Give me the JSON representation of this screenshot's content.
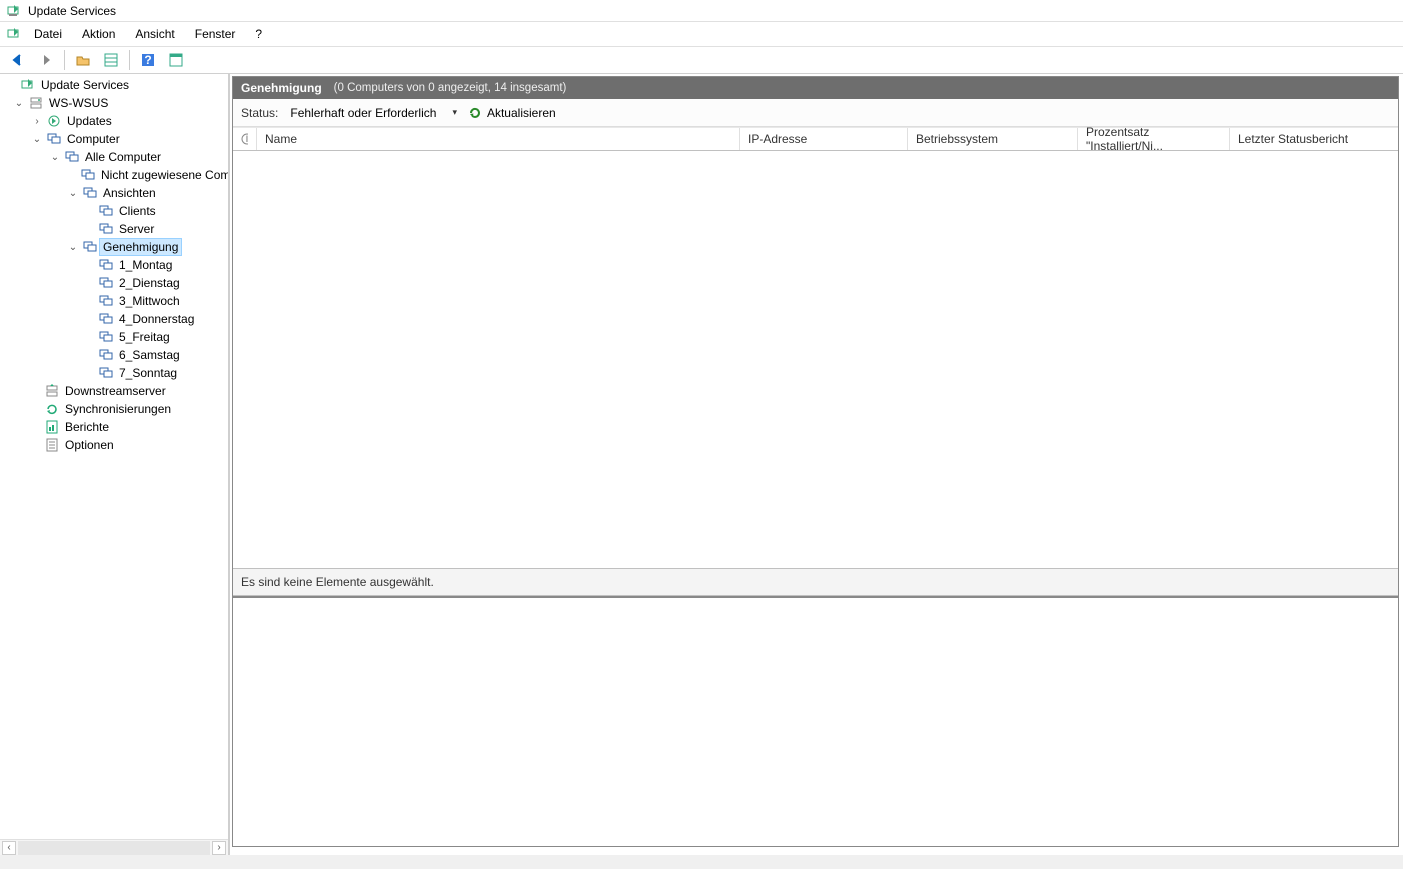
{
  "window": {
    "title": "Update Services"
  },
  "menu": {
    "items": [
      "Datei",
      "Aktion",
      "Ansicht",
      "Fenster",
      "?"
    ]
  },
  "tree": {
    "root": "Update Services",
    "server": "WS-WSUS",
    "updates": "Updates",
    "computer": "Computer",
    "all_computers": "Alle Computer",
    "unassigned": "Nicht zugewiesene Com",
    "views": "Ansichten",
    "clients": "Clients",
    "serverNode": "Server",
    "approval": "Genehmigung",
    "days": [
      "1_Montag",
      "2_Dienstag",
      "3_Mittwoch",
      "4_Donnerstag",
      "5_Freitag",
      "6_Samstag",
      "7_Sonntag"
    ],
    "downstream": "Downstreamserver",
    "syncs": "Synchronisierungen",
    "reports": "Berichte",
    "options": "Optionen"
  },
  "header": {
    "title": "Genehmigung",
    "subtitle": "(0 Computers von 0 angezeigt, 14 insgesamt)"
  },
  "filter": {
    "status_label": "Status:",
    "status_value": "Fehlerhaft oder Erforderlich",
    "refresh": "Aktualisieren"
  },
  "columns": {
    "name": "Name",
    "ip": "IP-Adresse",
    "os": "Betriebssystem",
    "pct": "Prozentsatz \"Installiert/Ni...",
    "last": "Letzter Statusbericht"
  },
  "status": {
    "no_selection": "Es sind keine Elemente ausgewählt."
  }
}
